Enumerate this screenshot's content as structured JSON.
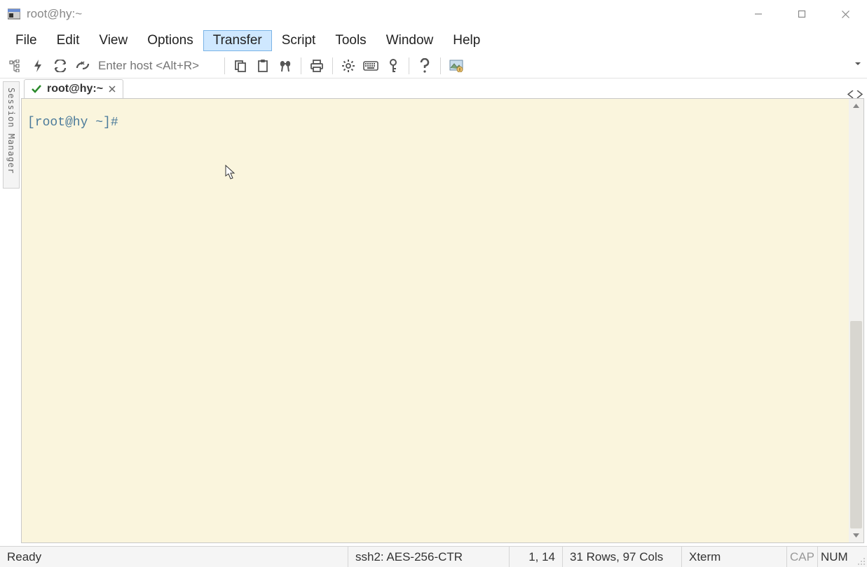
{
  "window": {
    "title": "root@hy:~"
  },
  "menu": {
    "items": [
      "File",
      "Edit",
      "View",
      "Options",
      "Transfer",
      "Script",
      "Tools",
      "Window",
      "Help"
    ],
    "active_index": 4
  },
  "toolbar": {
    "host_placeholder": "Enter host <Alt+R>"
  },
  "sidepanel": {
    "label": "Session Manager"
  },
  "tabs": {
    "items": [
      {
        "label": "root@hy:~",
        "connected": true
      }
    ]
  },
  "terminal": {
    "prompt": "[root@hy ~]#"
  },
  "status": {
    "ready": "Ready",
    "protocol": "ssh2: AES-256-CTR",
    "cursor": "1,  14",
    "dims": "31 Rows, 97 Cols",
    "termtype": "Xterm",
    "cap": "CAP",
    "num": "NUM"
  }
}
